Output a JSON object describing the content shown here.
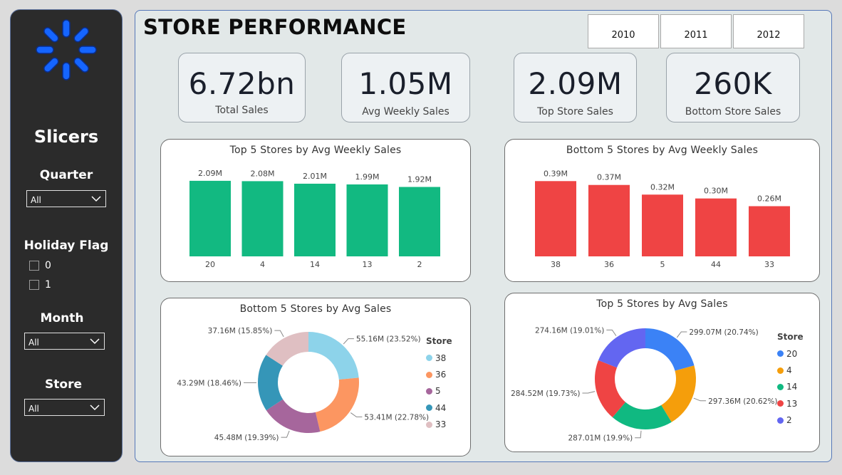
{
  "sidebar": {
    "title": "Slicers",
    "quarter": {
      "label": "Quarter",
      "value": "All"
    },
    "holiday_flag": {
      "label": "Holiday Flag",
      "options": [
        "0",
        "1"
      ]
    },
    "month": {
      "label": "Month",
      "value": "All"
    },
    "store": {
      "label": "Store",
      "value": "All"
    }
  },
  "header": {
    "title": "STORE PERFORMANCE",
    "years": [
      "2010",
      "2011",
      "2012"
    ]
  },
  "kpis": [
    {
      "value": "6.72bn",
      "label": "Total Sales"
    },
    {
      "value": "1.05M",
      "label": "Avg Weekly Sales"
    },
    {
      "value": "2.09M",
      "label": "Top Store Sales"
    },
    {
      "value": "260K",
      "label": "Bottom Store Sales"
    }
  ],
  "colors": {
    "top_bar": "#12b981",
    "bottom_bar": "#ef4444",
    "logo": "#1565ff"
  },
  "chart_data": [
    {
      "type": "bar",
      "title": "Top 5 Stores by Avg Weekly Sales",
      "categories": [
        "20",
        "4",
        "14",
        "13",
        "2"
      ],
      "values": [
        2.09,
        2.08,
        2.01,
        1.99,
        1.92
      ],
      "data_labels": [
        "2.09M",
        "2.08M",
        "2.01M",
        "1.99M",
        "1.92M"
      ],
      "ylim": [
        0,
        2.6
      ],
      "color": "#12b981"
    },
    {
      "type": "bar",
      "title": "Bottom 5 Stores by Avg Weekly Sales",
      "categories": [
        "38",
        "36",
        "5",
        "44",
        "33"
      ],
      "values": [
        0.39,
        0.37,
        0.32,
        0.3,
        0.26
      ],
      "data_labels": [
        "0.39M",
        "0.37M",
        "0.32M",
        "0.30M",
        "0.26M"
      ],
      "ylim": [
        0,
        0.487
      ],
      "color": "#ef4444"
    },
    {
      "type": "pie",
      "title": "Bottom 5 Stores by Avg Sales",
      "legend_title": "Store",
      "categories": [
        "38",
        "36",
        "5",
        "44",
        "33"
      ],
      "values": [
        55.16,
        53.41,
        45.48,
        43.29,
        37.16
      ],
      "data_labels": [
        "55.16M (23.52%)",
        "53.41M (22.78%)",
        "45.48M (19.39%)",
        "43.29M (18.46%)",
        "37.16M (15.85%)"
      ],
      "colors": [
        "#8dd3ea",
        "#fc9661",
        "#a6669c",
        "#3596b8",
        "#dfbfc2"
      ],
      "legend_placement": "right"
    },
    {
      "type": "pie",
      "title": "Top 5 Stores by Avg Sales",
      "legend_title": "Store",
      "categories": [
        "20",
        "4",
        "14",
        "13",
        "2"
      ],
      "values": [
        299.07,
        297.36,
        287.01,
        284.52,
        274.16
      ],
      "data_labels": [
        "299.07M (20.74%)",
        "297.36M (20.62%)",
        "287.01M (19.9%)",
        "284.52M (19.73%)",
        "274.16M (19.01%)"
      ],
      "colors": [
        "#3b82f6",
        "#f59e0b",
        "#10b981",
        "#ef4444",
        "#6366f1"
      ],
      "legend_placement": "right"
    }
  ]
}
